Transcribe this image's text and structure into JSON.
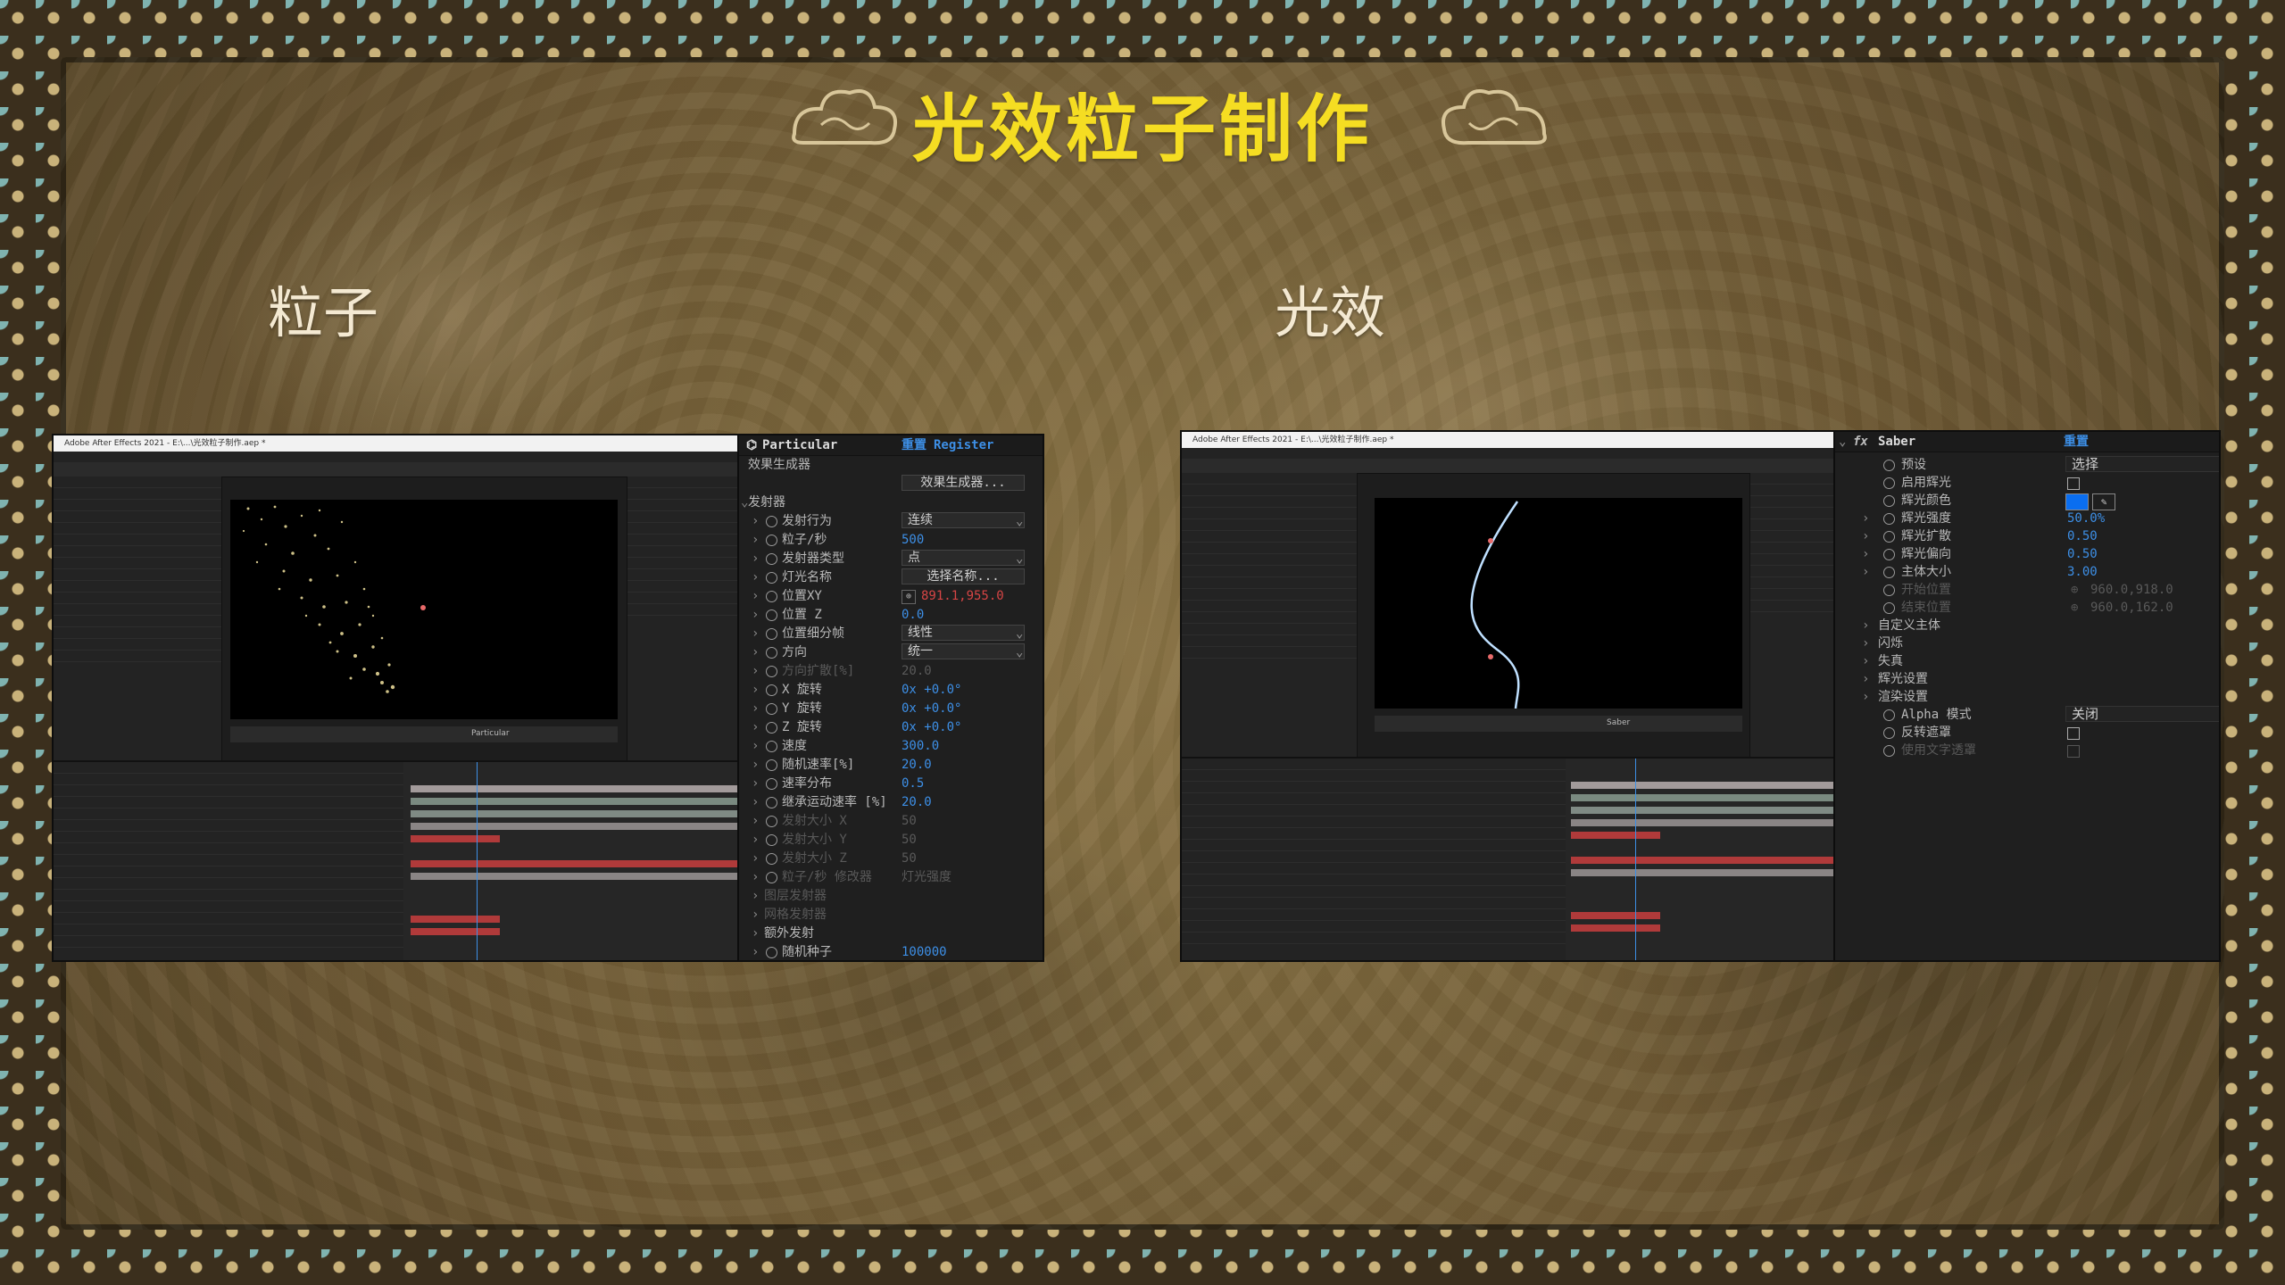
{
  "slide": {
    "title": "光效粒子制作",
    "left_subtitle": "粒子",
    "right_subtitle": "光效"
  },
  "left_screenshot": {
    "window_title": "Adobe After Effects 2021 - E:\\...\\光效粒子制作.aep *",
    "comp_renderer": "Particular"
  },
  "particular_panel": {
    "effect_name": "Particular",
    "reset_label": "重置",
    "register_label": "Register",
    "effect_builder_label": "效果生成器",
    "effect_builder_button": "效果生成器...",
    "emitter_group": "发射器",
    "rows": [
      {
        "label": "发射行为",
        "value": "连续",
        "kind": "dropdown"
      },
      {
        "label": "粒子/秒",
        "value": "500",
        "kind": "number"
      },
      {
        "label": "发射器类型",
        "value": "点",
        "kind": "dropdown"
      },
      {
        "label": "灯光名称",
        "value": "选择名称...",
        "kind": "button"
      },
      {
        "label": "位置XY",
        "value": "891.1,955.0",
        "kind": "point"
      },
      {
        "label": "位置 Z",
        "value": "0.0",
        "kind": "number"
      },
      {
        "label": "位置细分帧",
        "value": "线性",
        "kind": "dropdown"
      },
      {
        "label": "方向",
        "value": "统一",
        "kind": "dropdown"
      },
      {
        "label": "方向扩散[%]",
        "value": "20.0",
        "kind": "disabled"
      },
      {
        "label": "X 旋转",
        "value": "0x +0.0°",
        "kind": "number"
      },
      {
        "label": "Y 旋转",
        "value": "0x +0.0°",
        "kind": "number"
      },
      {
        "label": "Z 旋转",
        "value": "0x +0.0°",
        "kind": "number"
      },
      {
        "label": "速度",
        "value": "300.0",
        "kind": "number"
      },
      {
        "label": "随机速率[%]",
        "value": "20.0",
        "kind": "number"
      },
      {
        "label": "速率分布",
        "value": "0.5",
        "kind": "number"
      },
      {
        "label": "继承运动速率 [%]",
        "value": "20.0",
        "kind": "number"
      },
      {
        "label": "发射大小 X",
        "value": "50",
        "kind": "disabled"
      },
      {
        "label": "发射大小 Y",
        "value": "50",
        "kind": "disabled"
      },
      {
        "label": "发射大小 Z",
        "value": "50",
        "kind": "disabled"
      },
      {
        "label": "粒子/秒 修改器",
        "value": "灯光强度",
        "kind": "disabled"
      },
      {
        "label": "图层发射器",
        "value": "",
        "kind": "disabled-group"
      },
      {
        "label": "网格发射器",
        "value": "",
        "kind": "disabled-group"
      },
      {
        "label": "额外发射",
        "value": "",
        "kind": "group"
      },
      {
        "label": "随机种子",
        "value": "100000",
        "kind": "number"
      }
    ]
  },
  "right_screenshot": {
    "window_title": "Adobe After Effects 2021 - E:\\...\\光效粒子制作.aep *",
    "comp_renderer": "Saber"
  },
  "saber_panel": {
    "effect_name": "Saber",
    "fx_label": "fx",
    "reset_label": "重置",
    "rows": [
      {
        "label": "预设",
        "value": "选择",
        "kind": "dropdown"
      },
      {
        "label": "启用辉光",
        "value": "",
        "kind": "checkbox"
      },
      {
        "label": "辉光颜色",
        "value": "#0a6ef0",
        "kind": "color"
      },
      {
        "label": "辉光强度",
        "value": "50.0%",
        "kind": "number"
      },
      {
        "label": "辉光扩散",
        "value": "0.50",
        "kind": "number"
      },
      {
        "label": "辉光偏向",
        "value": "0.50",
        "kind": "number"
      },
      {
        "label": "主体大小",
        "value": "3.00",
        "kind": "number"
      },
      {
        "label": "开始位置",
        "value": "960.0,918.0",
        "kind": "disabled-point"
      },
      {
        "label": "结束位置",
        "value": "960.0,162.0",
        "kind": "disabled-point"
      },
      {
        "label": "自定义主体",
        "value": "",
        "kind": "group"
      },
      {
        "label": "闪烁",
        "value": "",
        "kind": "group"
      },
      {
        "label": "失真",
        "value": "",
        "kind": "group"
      },
      {
        "label": "辉光设置",
        "value": "",
        "kind": "group"
      },
      {
        "label": "渲染设置",
        "value": "",
        "kind": "group"
      },
      {
        "label": "Alpha 模式",
        "value": "关闭",
        "kind": "dropdown"
      },
      {
        "label": "反转遮罩",
        "value": "",
        "kind": "checkbox"
      },
      {
        "label": "使用文字透罩",
        "value": "",
        "kind": "disabled-checkbox"
      }
    ]
  },
  "colors": {
    "title": "#f5dd22",
    "accent_blue": "#3d8fe6",
    "saber_glow": "#0a6ef0",
    "timeline_red": "#b03a3a"
  }
}
